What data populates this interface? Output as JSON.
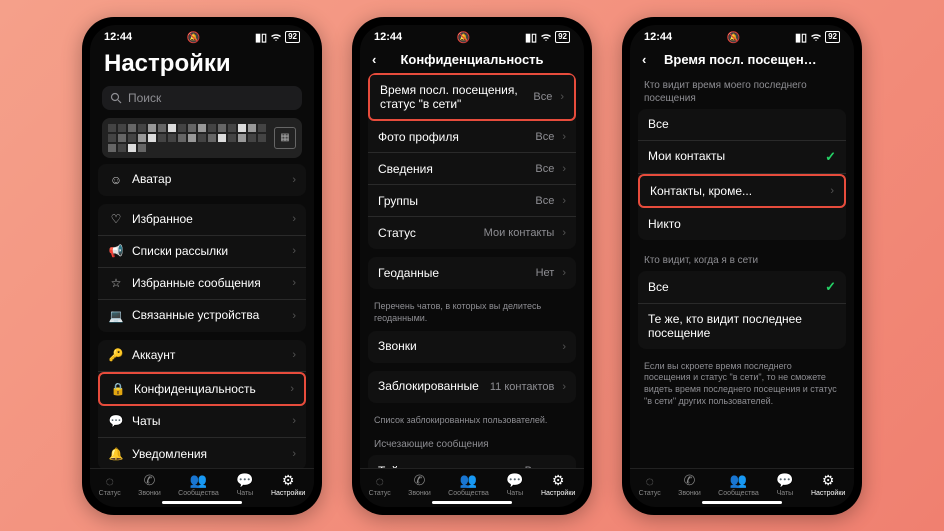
{
  "status": {
    "time": "12:44",
    "battery": "92"
  },
  "screen1": {
    "title": "Настройки",
    "search_placeholder": "Поиск",
    "avatar": "Аватар",
    "fav": "Избранное",
    "broadcast": "Списки рассылки",
    "starred": "Избранные сообщения",
    "linked": "Связанные устройства",
    "account": "Аккаунт",
    "privacy": "Конфиденциальность",
    "chats": "Чаты",
    "notifications": "Уведомления"
  },
  "screen2": {
    "header": "Конфиденциальность",
    "lastseen": "Время посл. посещения, статус \"в сети\"",
    "photo": "Фото профиля",
    "about": "Сведения",
    "groups": "Группы",
    "status": "Статус",
    "v_all": "Все",
    "v_contacts": "Мои контакты",
    "geo": "Геоданные",
    "geo_val": "Нет",
    "geo_note": "Перечень чатов, в которых вы делитесь геоданными.",
    "calls": "Звонки",
    "blocked": "Заблокированные",
    "blocked_val": "11 контактов",
    "blocked_note": "Список заблокированных пользователей.",
    "disappearing": "Исчезающие сообщения",
    "timer": "Таймер",
    "timer_val": "Выкл."
  },
  "screen3": {
    "header": "Время посл. посещения, статус \"в се...",
    "q1": "Кто видит время моего последнего посещения",
    "opt_all": "Все",
    "opt_contacts": "Мои контакты",
    "opt_except": "Контакты, кроме...",
    "opt_nobody": "Никто",
    "q2": "Кто видит, когда я в сети",
    "opt_same": "Те же, кто видит последнее посещение",
    "note": "Если вы скроете время последнего посещения и статус \"в сети\", то не сможете видеть время последнего посещения и статус \"в сети\" других пользователей."
  },
  "tabs": {
    "status": "Статус",
    "calls": "Звонки",
    "communities": "Сообщества",
    "chats": "Чаты",
    "settings": "Настройки"
  }
}
